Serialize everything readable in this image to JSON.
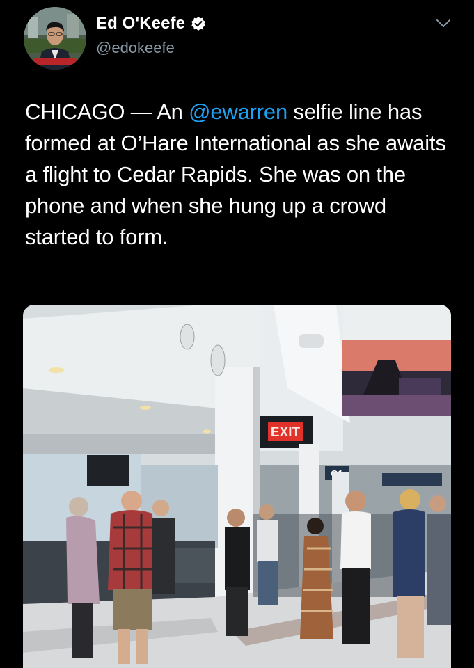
{
  "author": {
    "display_name": "Ed O'Keefe",
    "handle": "@edokeefe",
    "verified": true,
    "avatar_icon": "profile-photo"
  },
  "tweet": {
    "text_before": "CHICAGO — An ",
    "mention": "@ewarren",
    "text_after": " selfie line has formed at O’Hare International as she awaits a flight to Cedar Rapids. She was on the phone and when she hung up a crowd started to form."
  },
  "photo": {
    "exit_sign": "EXIT",
    "gate_sign": "G1"
  },
  "colors": {
    "background": "#000000",
    "mention": "#1da1f2",
    "handle": "#8899a6",
    "verified": "#ffffff"
  }
}
